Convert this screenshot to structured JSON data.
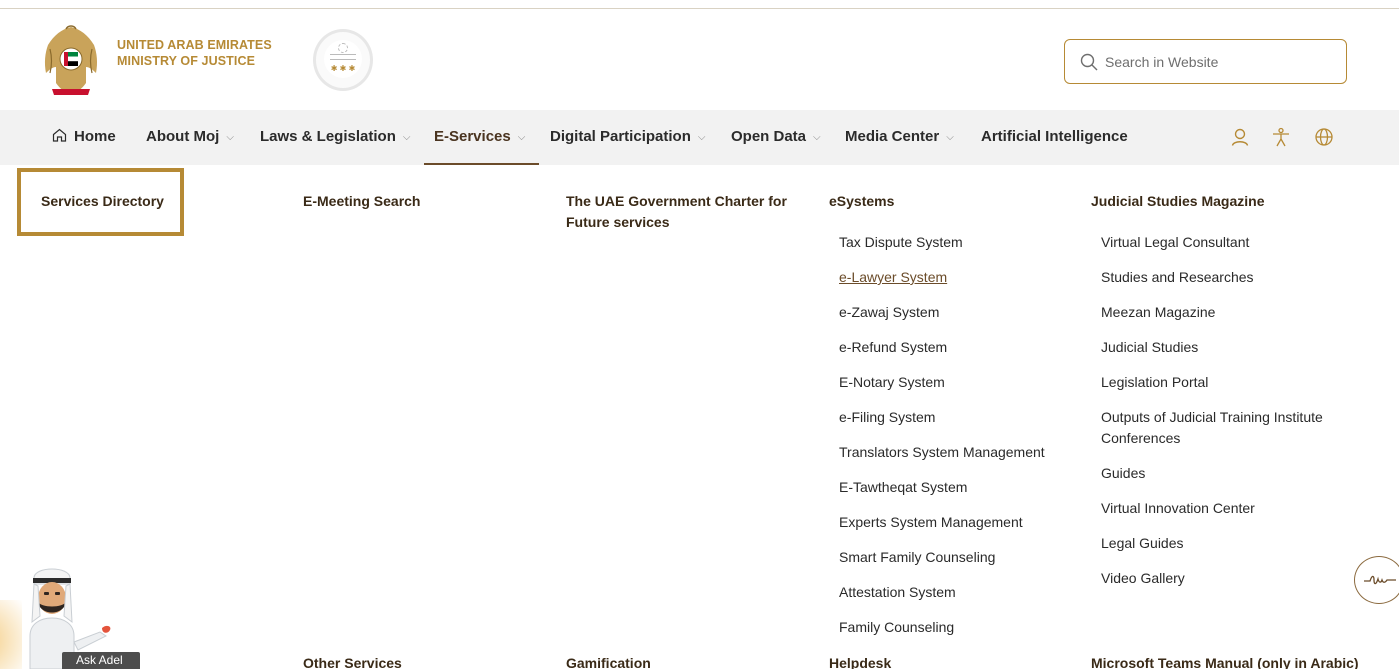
{
  "header": {
    "brand_line1": "UNITED ARAB EMIRATES",
    "brand_line2": "MINISTRY OF JUSTICE",
    "search_placeholder": "Search in Website",
    "accent_color": "#b68a35"
  },
  "nav": {
    "items": [
      {
        "label": "Home",
        "dropdown": false
      },
      {
        "label": "About Moj",
        "dropdown": true
      },
      {
        "label": "Laws & Legislation",
        "dropdown": true
      },
      {
        "label": "E-Services",
        "dropdown": true,
        "active": true
      },
      {
        "label": "Digital Participation",
        "dropdown": true
      },
      {
        "label": "Open Data",
        "dropdown": true
      },
      {
        "label": "Media Center",
        "dropdown": true
      },
      {
        "label": "Artificial Intelligence",
        "dropdown": false
      }
    ],
    "utility_icons": [
      "user-icon",
      "accessibility-icon",
      "globe-icon"
    ]
  },
  "menu": {
    "col1": {
      "heading": "Services Directory"
    },
    "col2": {
      "heading": "E-Meeting Search",
      "footer": "Other Services"
    },
    "col3": {
      "heading": "The UAE Government Charter for Future services",
      "footer": "Gamification"
    },
    "col4": {
      "heading": "eSystems",
      "items": [
        "Tax Dispute System",
        "e-Lawyer System",
        "e-Zawaj System",
        "e-Refund System",
        "E-Notary System",
        "e-Filing System",
        "Translators System Management",
        "E-Tawtheqat System",
        "Experts System Management",
        "Smart Family Counseling",
        "Attestation System",
        "Family Counseling"
      ],
      "footer": "Helpdesk"
    },
    "col5": {
      "heading": "Judicial Studies Magazine",
      "items": [
        "Virtual Legal Consultant",
        "Studies and Researches",
        "Meezan Magazine",
        "Judicial Studies",
        "Legislation Portal",
        "Outputs of Judicial Training Institute Conferences",
        "Guides",
        "Virtual Innovation Center",
        "Legal Guides",
        "Video Gallery"
      ],
      "footer": "Microsoft Teams Manual (only in Arabic)"
    }
  },
  "assistant": {
    "label": "Ask Adel"
  }
}
